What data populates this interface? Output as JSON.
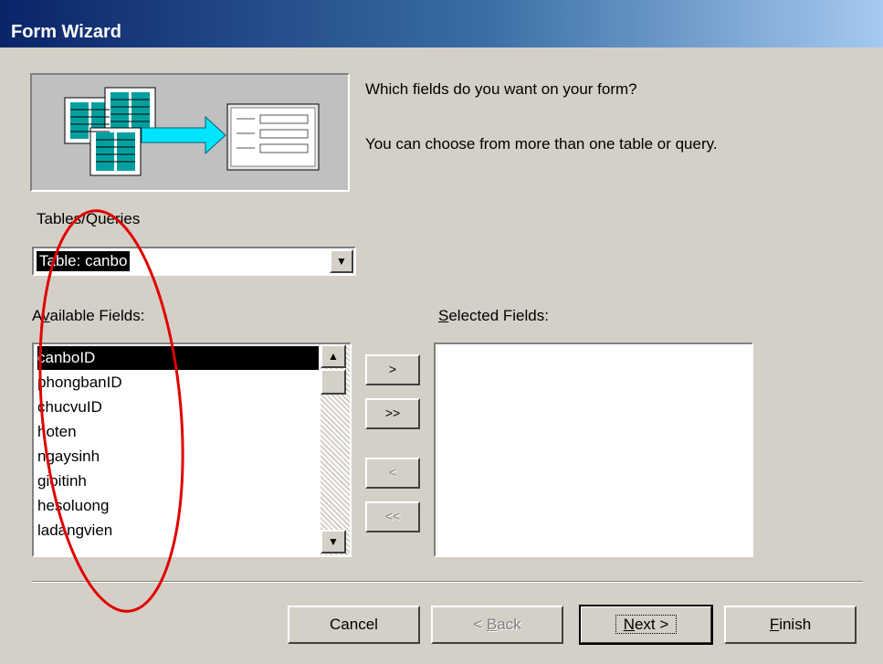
{
  "window": {
    "title": "Form Wizard"
  },
  "header": {
    "question": "Which fields do you want on your form?",
    "hint": "You can choose from more than one table or query."
  },
  "tables_queries": {
    "label": "Tables/Queries",
    "selected": "Table: canbo"
  },
  "available_fields": {
    "label_prefix": "A",
    "label_mnemonic": "v",
    "label_rest": "ailable Fields:",
    "items": [
      "canboID",
      "phongbanID",
      "chucvuID",
      "hoten",
      "ngaysinh",
      "gioitinh",
      "hesoluong",
      "ladangvien"
    ],
    "selected_index": 0
  },
  "selected_fields": {
    "label_mnemonic": "S",
    "label_rest": "elected Fields:",
    "items": []
  },
  "move_buttons": {
    "add_one": ">",
    "add_all": ">>",
    "remove_one": "<",
    "remove_all": "<<"
  },
  "buttons": {
    "cancel": "Cancel",
    "back_prefix": "< ",
    "back_mnemonic": "B",
    "back_rest": "ack",
    "next_mnemonic": "N",
    "next_rest": "ext >",
    "finish_mnemonic": "F",
    "finish_rest": "inish"
  },
  "annotation": {
    "color": "#e00000"
  },
  "icons": [
    "form-wizard-illustration",
    "dropdown-arrow-icon",
    "scroll-up-icon",
    "scroll-down-icon"
  ]
}
